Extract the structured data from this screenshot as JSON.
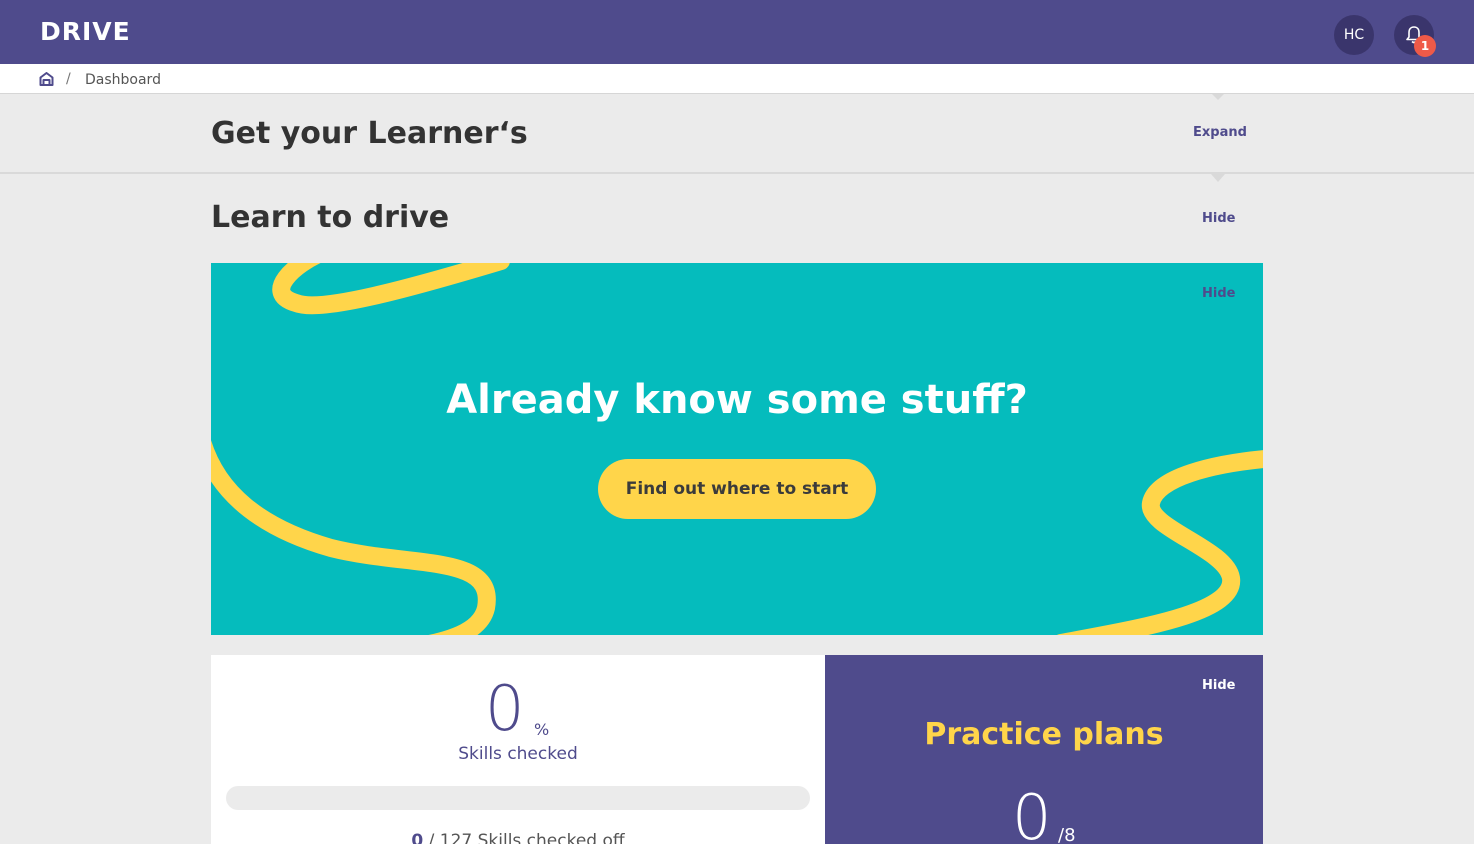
{
  "app": {
    "logo": "DRIVE"
  },
  "header": {
    "avatar_initials": "HC",
    "notification_count": "1"
  },
  "breadcrumb": {
    "current": "Dashboard",
    "separator": "/"
  },
  "section_learners": {
    "title": "Get your Learner‘s",
    "action": "Expand"
  },
  "section_learn": {
    "title": "Learn to drive",
    "action": "Hide"
  },
  "banner": {
    "hide_label": "Hide",
    "title": "Already know some stuff?",
    "cta_label": "Find out where to start"
  },
  "skills": {
    "value": "0",
    "unit": "%",
    "label": "Skills checked",
    "progress_fraction": 0,
    "checked": "0",
    "count_suffix": " / 127 Skills checked off"
  },
  "plans": {
    "hide_label": "Hide",
    "title": "Practice plans",
    "value": "0",
    "total": "/8"
  },
  "colors": {
    "brand": "#4f4b8c",
    "teal": "#05bcbd",
    "yellow": "#ffd54a",
    "badge": "#ef5a48"
  }
}
